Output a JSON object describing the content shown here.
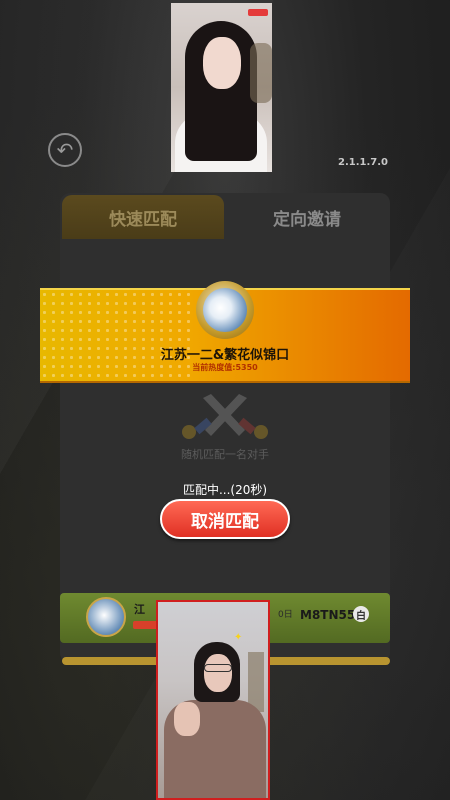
{
  "header": {
    "version": "2.1.1.7.0"
  },
  "tabs": [
    {
      "label": "快速匹配",
      "active": true
    },
    {
      "label": "定向邀请",
      "active": false
    }
  ],
  "player": {
    "name": "江苏一二&繁花似锦口",
    "heat": "当前热度值:5350"
  },
  "match": {
    "description": "随机匹配一名对手",
    "status": "匹配中...(20秒)",
    "cancel_label": "取消匹配"
  },
  "ribbon": {
    "name": "江",
    "code": "M8TN55",
    "badge": "白",
    "sep": "0日"
  },
  "colors": {
    "banner_start": "#e8b800",
    "banner_end": "#e46a00",
    "cancel_button": "#e03024",
    "ribbon": "#6f8a30",
    "video_border": "#d01e1e"
  },
  "icons": {
    "back": "back-arrow-icon",
    "swords": "crossed-swords-icon"
  }
}
